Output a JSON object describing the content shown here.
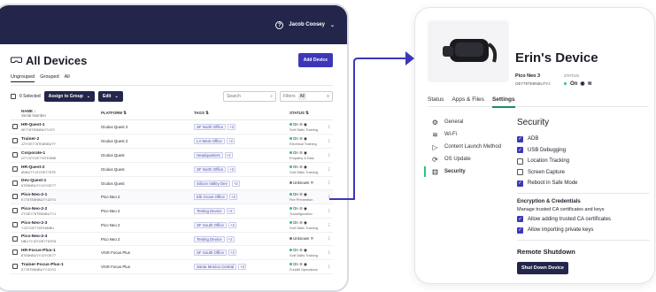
{
  "topbar": {
    "user_name": "Jacob Coosey"
  },
  "page": {
    "title": "All Devices",
    "add_button": "Add Device"
  },
  "tabs": [
    "Ungrouped",
    "Grouped",
    "All"
  ],
  "toolbar": {
    "selected": "0 Selected",
    "assign": "Assign to Group",
    "edit": "Edit",
    "search_placeholder": "Search",
    "filters_label": "Filters",
    "filters_value": "All"
  },
  "table": {
    "headers": {
      "name": "NAME",
      "serial": "Serial Number",
      "platform": "PLATFORM",
      "tags": "TAGS",
      "status": "STATUS"
    },
    "rows": [
      {
        "name": "HR-Quest-1",
        "serial": "0E778TE8NBU7YJZY",
        "platform": "Oculus Quest 2",
        "tag": "SF North Office",
        "more": "+2",
        "status": "On",
        "sub": "Soft Skills Training",
        "online": true
      },
      {
        "name": "Trainer-2",
        "serial": "JZYOE778TE8NBU7Y",
        "platform": "Oculus Quest 2",
        "tag": "LA West Office",
        "more": "+2",
        "status": "On",
        "sub": "Electrical Training",
        "online": true
      },
      {
        "name": "Corporate-1",
        "serial": "U7YJZYOE778TE8NB",
        "platform": "Oculus Quest",
        "tag": "Headquarters",
        "more": "+2",
        "status": "On",
        "sub": "Empathy & Bias",
        "online": true
      },
      {
        "name": "HR-Quest-2",
        "serial": "8NBU7YJZYOE778TE",
        "platform": "Oculus Quest",
        "tag": "SF North Office",
        "more": "+2",
        "status": "On",
        "sub": "Soft Skills Training",
        "online": true
      },
      {
        "name": "Dev-Quest-1",
        "serial": "8TE8NBU7YJZYOE77",
        "platform": "Oculus Quest",
        "tag": "Silicon Valley Dev",
        "more": "+2",
        "status": "Unknown",
        "sub": "",
        "online": false
      },
      {
        "name": "Pico-Neo-2-1",
        "serial": "E778TE8NBU7YJZYO",
        "platform": "Pico Neo 2",
        "tag": "Elk Grove Office",
        "more": "+2",
        "status": "On",
        "sub": "Fire Prevention",
        "online": true
      },
      {
        "name": "Pico-Neo-2-2",
        "serial": "ZYOE778TE8NBU7YJ",
        "platform": "Pico Neo 2",
        "tag": "Testing Device",
        "more": "+2",
        "status": "On",
        "sub": "Transfiguration",
        "online": true
      },
      {
        "name": "Pico-Neo-2-3",
        "serial": "YJZYOE778TE8NBU",
        "platform": "Pico Neo 2",
        "tag": "SF South Office",
        "more": "+2",
        "status": "On",
        "sub": "Soft Skills Training",
        "online": true
      },
      {
        "name": "Pico-Neo-2-4",
        "serial": "NBU7YJZYOE778TE8",
        "platform": "Pico Neo 2",
        "tag": "Testing Device",
        "more": "+2",
        "status": "Unknown",
        "sub": "",
        "online": false
      },
      {
        "name": "HR-Focus-Plus-1",
        "serial": "8TE8NBU7YJZYOE77",
        "platform": "VIVE Focus Plus",
        "tag": "SF South Office",
        "more": "+2",
        "status": "On",
        "sub": "Soft Skills Training",
        "online": true
      },
      {
        "name": "Trainer-Focus-Plus-1",
        "serial": "E778TE8NBU7YJZYO",
        "platform": "VIVE Focus Plus",
        "tag": "Santa Monica Central",
        "more": "+2",
        "status": "On",
        "sub": "Forklift Operations",
        "online": true
      }
    ]
  },
  "device": {
    "name": "Erin's Device",
    "model": "Pico Neo 3",
    "serial": "OE778TE8NBU7YJ",
    "status_label": "STATUS",
    "status_value": "On",
    "tabs": [
      "Status",
      "Apps & Files",
      "Settings"
    ],
    "sidebar": [
      "General",
      "Wi-Fi",
      "Content Launch Method",
      "OS Update",
      "Security"
    ],
    "security": {
      "title": "Security",
      "options": [
        {
          "label": "ADB",
          "checked": true
        },
        {
          "label": "USB Debugging",
          "checked": true
        },
        {
          "label": "Location Tracking",
          "checked": false
        },
        {
          "label": "Screen Capture",
          "checked": false
        },
        {
          "label": "Reboot in Safe Mode",
          "checked": true
        }
      ],
      "enc_title": "Encryption & Credentials",
      "enc_desc": "Manage trusted CA certificates and keys",
      "enc_options": [
        {
          "label": "Allow adding trusted CA certificates",
          "checked": true
        },
        {
          "label": "Allow importing private keys",
          "checked": true
        }
      ],
      "remote_title": "Remote Shutdown",
      "shutdown_button": "Shut Down Device"
    }
  },
  "colors": {
    "navy": "#23264a",
    "accent": "#3d37b8",
    "online": "#2ec27e",
    "unknown": "#777777"
  }
}
